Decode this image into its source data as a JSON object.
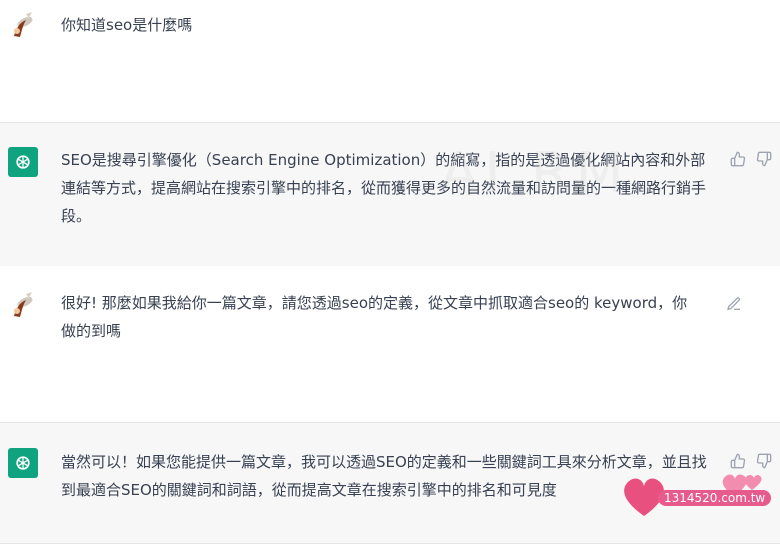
{
  "conversation": [
    {
      "role": "user",
      "text": "你知道seo是什麼嗎"
    },
    {
      "role": "assistant",
      "text": "SEO是搜尋引擎優化（Search Engine Optimization）的縮寫，指的是透過優化網站內容和外部連結等方式，提高網站在搜索引擎中的排名，從而獲得更多的自然流量和訪問量的一種網路行銷手段。"
    },
    {
      "role": "user",
      "text": "很好! 那麼如果我給你一篇文章，請您透過seo的定義，從文章中抓取適合seo的 keyword，你做的到嗎"
    },
    {
      "role": "assistant",
      "text": "當然可以！如果您能提供一篇文章，我可以透過SEO的定義和一些關鍵詞工具來分析文章，並且找到最適合SEO的關鍵詞和詞語，從而提高文章在搜索引擎中的排名和可見度"
    }
  ],
  "watermark": "AI RM",
  "logo": {
    "text": "1314520.com.tw"
  },
  "icons": {
    "thumbs_up": "thumbs-up-icon",
    "thumbs_down": "thumbs-down-icon",
    "edit": "edit-icon"
  },
  "colors": {
    "gpt_green": "#10a37f",
    "bot_bg": "#f7f7f8",
    "logo_pink": "#e75a8c"
  }
}
